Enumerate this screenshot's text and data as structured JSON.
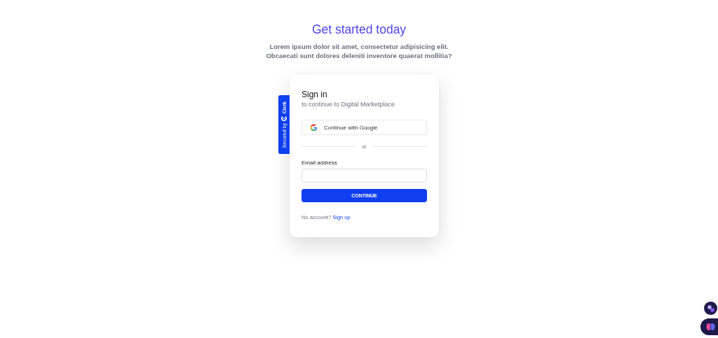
{
  "header": {
    "title": "Get started today",
    "subtitle_lines": [
      "Lorem ipsum dolor sit amet, consectetur adipisicing elit.",
      "Obcaecati sunt dolores deleniti inventore quaerat mollitia?"
    ]
  },
  "badge": {
    "prefix": "Secured by",
    "brand": "Clerk"
  },
  "card": {
    "title": "Sign in",
    "subtitle": "to continue to Digital Marketplace",
    "google_button": "Continue with Google",
    "divider": "or",
    "email_label": "Email address",
    "continue_button": "CONTINUE",
    "footer_text": "No account?",
    "footer_link": "Sign up"
  }
}
